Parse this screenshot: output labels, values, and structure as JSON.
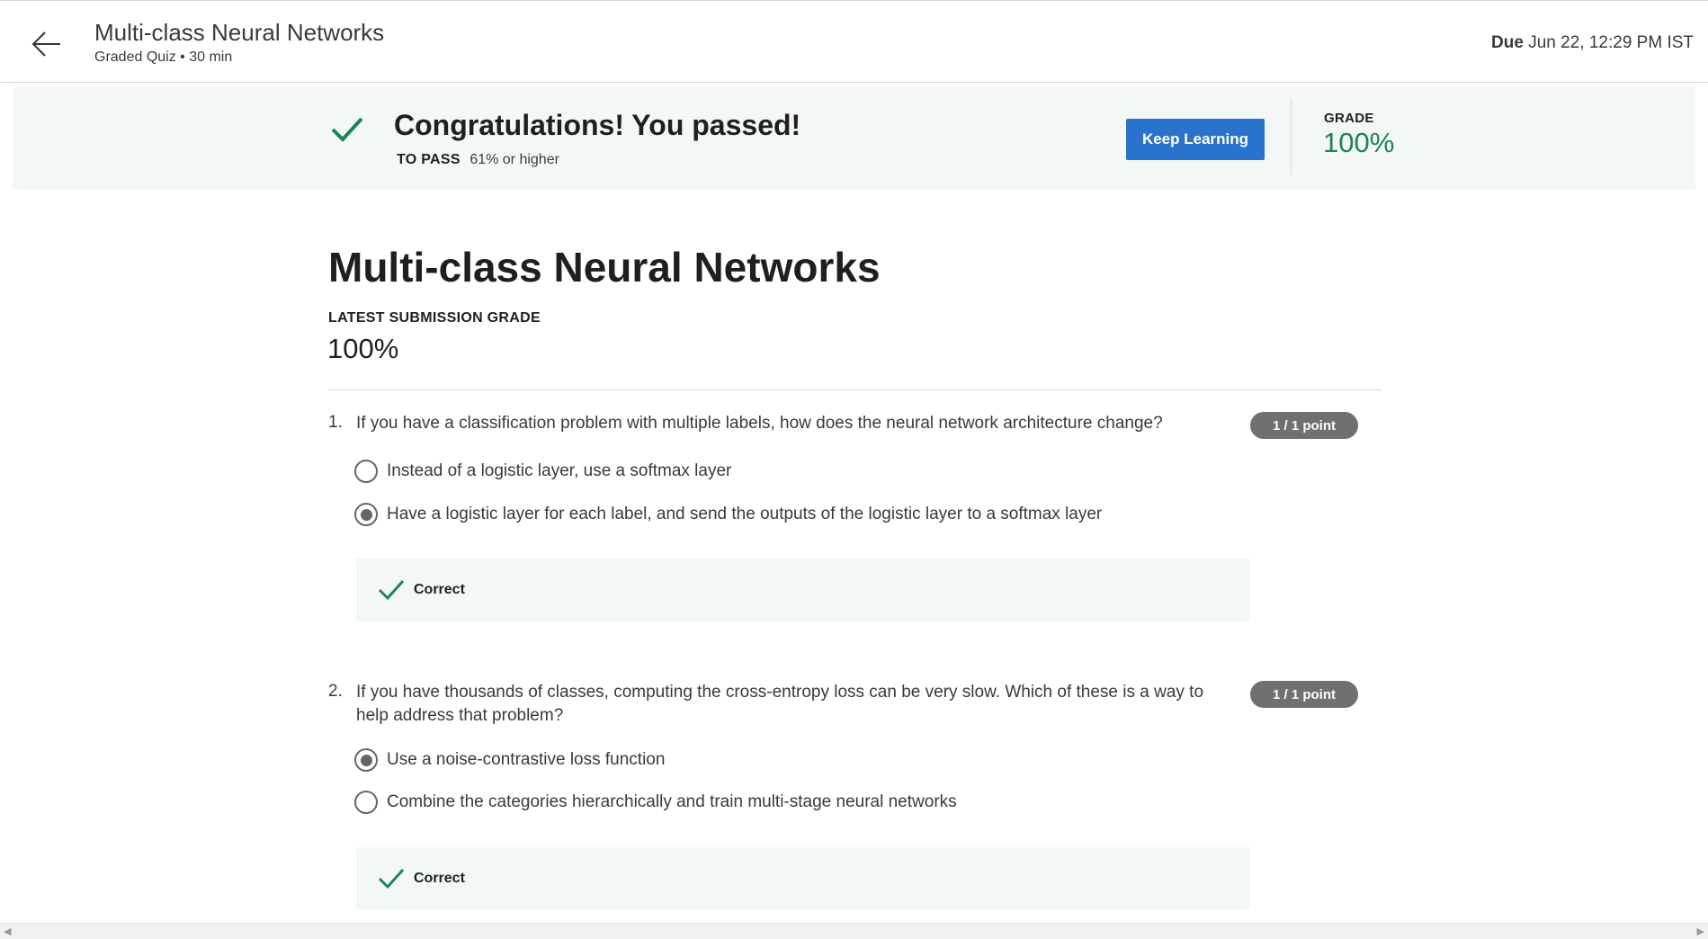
{
  "header": {
    "title": "Multi-class Neural Networks",
    "subtitle": "Graded Quiz • 30 min",
    "due_label": "Due",
    "due_value": "Jun 22, 12:29 PM IST"
  },
  "banner": {
    "message": "Congratulations! You passed!",
    "to_pass_label": "TO PASS",
    "to_pass_value": "61% or higher",
    "button_label": "Keep Learning",
    "grade_label": "GRADE",
    "grade_value": "100%"
  },
  "quiz": {
    "title": "Multi-class Neural Networks",
    "latest_label": "LATEST SUBMISSION GRADE",
    "latest_value": "100%",
    "questions": [
      {
        "number": "1.",
        "text": "If you have a classification problem with multiple labels, how does the neural network architecture change?",
        "points": "1 / 1 point",
        "options": [
          {
            "label": "Instead of a logistic layer, use a softmax layer",
            "selected": false
          },
          {
            "label": "Have a logistic layer for each label, and send the outputs of the logistic layer to a softmax layer",
            "selected": true
          }
        ],
        "feedback": "Correct"
      },
      {
        "number": "2.",
        "text": "If you have thousands of classes, computing the cross-entropy loss can be very slow. Which of these is a way to help address that problem?",
        "points": "1 / 1 point",
        "options": [
          {
            "label": "Use a noise-contrastive loss function",
            "selected": true
          },
          {
            "label": "Combine the categories hierarchically and train multi-stage neural networks",
            "selected": false
          }
        ],
        "feedback": "Correct"
      }
    ]
  },
  "colors": {
    "accent_green": "#1f8354",
    "button_blue": "#2a73cc",
    "banner_bg": "#f3f8f6",
    "points_badge": "#707070"
  },
  "icons": {
    "back": "arrow-left-icon",
    "pass": "checkmark-icon",
    "feedback": "checkmark-icon"
  }
}
